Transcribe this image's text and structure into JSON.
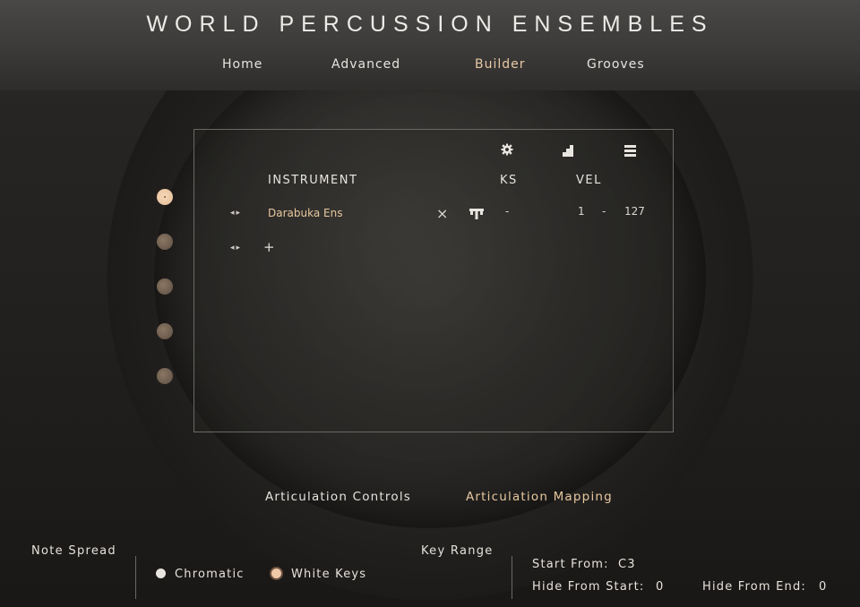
{
  "app": {
    "title": "WORLD PERCUSSION ENSEMBLES"
  },
  "nav": [
    {
      "label": "Home",
      "active": false
    },
    {
      "label": "Advanced",
      "active": false
    },
    {
      "label": "Builder",
      "active": true
    },
    {
      "label": "Grooves",
      "active": false
    }
  ],
  "builder": {
    "columns": {
      "instrument": "INSTRUMENT",
      "ks": "KS",
      "vel": "VEL"
    },
    "icons": [
      "gear-icon",
      "stairs-icon",
      "list-icon"
    ],
    "rows": [
      {
        "arrows": "◂▸",
        "instrument": "Darabuka Ens",
        "remove": "×",
        "ks": "-",
        "vel_min": "1",
        "vel_sep": "-",
        "vel_max": "127"
      }
    ],
    "add_row": {
      "arrows": "◂▸",
      "plus": "+"
    }
  },
  "slots": [
    {
      "active": true
    },
    {
      "active": false
    },
    {
      "active": false
    },
    {
      "active": false
    },
    {
      "active": false
    }
  ],
  "tabs": {
    "controls": "Articulation Controls",
    "mapping": "Articulation Mapping",
    "active": "mapping"
  },
  "note_spread": {
    "label": "Note Spread",
    "options": [
      {
        "label": "Chromatic",
        "selected": false
      },
      {
        "label": "White Keys",
        "selected": true
      }
    ]
  },
  "key_range": {
    "label": "Key Range",
    "start_from_label": "Start From:",
    "start_from_value": "C3",
    "hide_start_label": "Hide From Start:",
    "hide_start_value": "0",
    "hide_end_label": "Hide From End:",
    "hide_end_value": "0"
  },
  "colors": {
    "accent": "#e8c8a0",
    "background": "#1d1b19",
    "header": "#3c3a38"
  }
}
